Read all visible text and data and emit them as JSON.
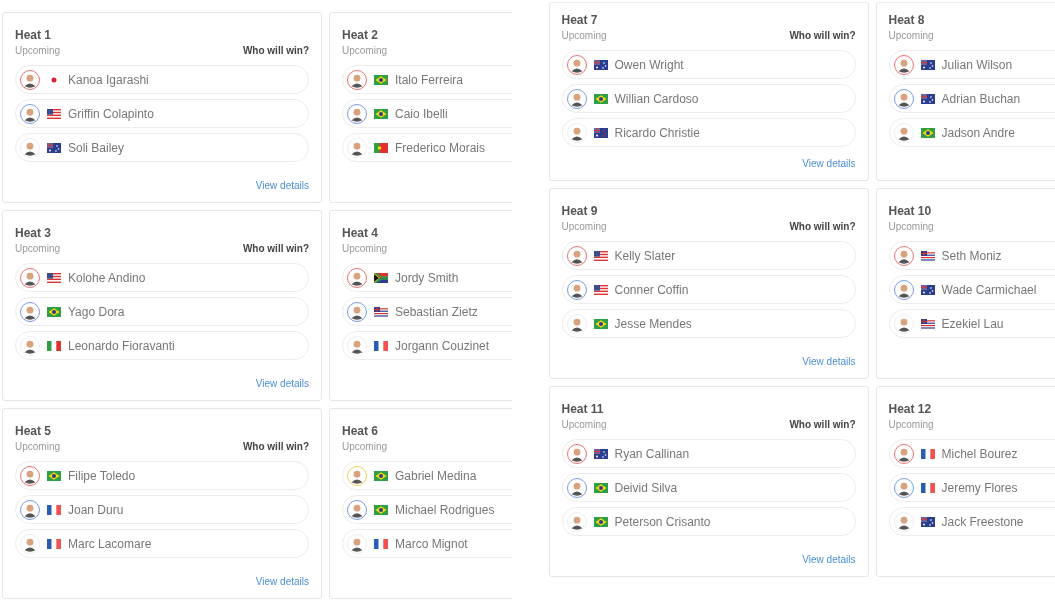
{
  "panels": [
    {
      "heats": [
        {
          "title": "Heat 1",
          "status": "Upcoming",
          "prompt": "Who will win?",
          "link": "View details",
          "surfers": [
            {
              "name": "Kanoa Igarashi",
              "kind": "jp",
              "color": "#e57373"
            },
            {
              "name": "Griffin Colapinto",
              "kind": "us",
              "color": "#7b9be0"
            },
            {
              "name": "Soli Bailey",
              "kind": "au",
              "color": "#eeeeee"
            }
          ]
        },
        {
          "title": "Heat 2",
          "status": "Upcoming",
          "surfers": [
            {
              "name": "Italo Ferreira",
              "kind": "br",
              "color": "#e57373"
            },
            {
              "name": "Caio Ibelli",
              "kind": "br",
              "color": "#7b9be0"
            },
            {
              "name": "Frederico Morais",
              "kind": "pt",
              "color": "#eeeeee"
            }
          ]
        },
        {
          "title": "Heat 3",
          "status": "Upcoming",
          "prompt": "Who will win?",
          "link": "View details",
          "surfers": [
            {
              "name": "Kolohe Andino",
              "kind": "us",
              "color": "#e57373"
            },
            {
              "name": "Yago Dora",
              "kind": "br",
              "color": "#7b9be0"
            },
            {
              "name": "Leonardo Fioravanti",
              "kind": "it",
              "color": "#eeeeee"
            }
          ]
        },
        {
          "title": "Heat 4",
          "status": "Upcoming",
          "surfers": [
            {
              "name": "Jordy Smith",
              "kind": "za",
              "color": "#e57373"
            },
            {
              "name": "Sebastian Zietz",
              "kind": "hi",
              "color": "#7b9be0"
            },
            {
              "name": "Jorgann Couzinet",
              "kind": "fr",
              "color": "#eeeeee"
            }
          ]
        },
        {
          "title": "Heat 5",
          "status": "Upcoming",
          "prompt": "Who will win?",
          "link": "View details",
          "surfers": [
            {
              "name": "Filipe Toledo",
              "kind": "br",
              "color": "#e57373"
            },
            {
              "name": "Joan Duru",
              "kind": "fr",
              "color": "#7b9be0"
            },
            {
              "name": "Marc Lacomare",
              "kind": "fr",
              "color": "#eeeeee"
            }
          ]
        },
        {
          "title": "Heat 6",
          "status": "Upcoming",
          "surfers": [
            {
              "name": "Gabriel Medina",
              "kind": "br",
              "color": "#f0d060"
            },
            {
              "name": "Michael Rodrigues",
              "kind": "br",
              "color": "#7b9be0"
            },
            {
              "name": "Marco Mignot",
              "kind": "fr",
              "color": "#eeeeee"
            }
          ]
        }
      ]
    },
    {
      "heats": [
        {
          "title": "Heat 7",
          "status": "Upcoming",
          "prompt": "Who will win?",
          "link": "View details",
          "surfers": [
            {
              "name": "Owen Wright",
              "kind": "au",
              "color": "#e57373"
            },
            {
              "name": "Willian Cardoso",
              "kind": "br",
              "color": "#7b9be0"
            },
            {
              "name": "Ricardo Christie",
              "kind": "nz",
              "color": "#eeeeee"
            }
          ]
        },
        {
          "title": "Heat 8",
          "status": "Upcoming",
          "surfers": [
            {
              "name": "Julian Wilson",
              "kind": "au",
              "color": "#e57373"
            },
            {
              "name": "Adrian Buchan",
              "kind": "au",
              "color": "#7b9be0"
            },
            {
              "name": "Jadson Andre",
              "kind": "br",
              "color": "#eeeeee"
            }
          ]
        },
        {
          "title": "Heat 9",
          "status": "Upcoming",
          "prompt": "Who will win?",
          "link": "View details",
          "surfers": [
            {
              "name": "Kelly Slater",
              "kind": "us",
              "color": "#e57373"
            },
            {
              "name": "Conner Coffin",
              "kind": "us",
              "color": "#7b9be0"
            },
            {
              "name": "Jesse Mendes",
              "kind": "br",
              "color": "#eeeeee"
            }
          ]
        },
        {
          "title": "Heat 10",
          "status": "Upcoming",
          "surfers": [
            {
              "name": "Seth Moniz",
              "kind": "hi",
              "color": "#e57373"
            },
            {
              "name": "Wade Carmichael",
              "kind": "au",
              "color": "#7b9be0"
            },
            {
              "name": "Ezekiel Lau",
              "kind": "hi",
              "color": "#eeeeee"
            }
          ]
        },
        {
          "title": "Heat 11",
          "status": "Upcoming",
          "prompt": "Who will win?",
          "link": "View details",
          "surfers": [
            {
              "name": "Ryan Callinan",
              "kind": "au",
              "color": "#e57373"
            },
            {
              "name": "Deivid Silva",
              "kind": "br",
              "color": "#7b9be0"
            },
            {
              "name": "Peterson Crisanto",
              "kind": "br",
              "color": "#eeeeee"
            }
          ]
        },
        {
          "title": "Heat 12",
          "status": "Upcoming",
          "surfers": [
            {
              "name": "Michel Bourez",
              "kind": "fr",
              "color": "#e57373"
            },
            {
              "name": "Jeremy Flores",
              "kind": "fr",
              "color": "#7b9be0"
            },
            {
              "name": "Jack Freestone",
              "kind": "au",
              "color": "#eeeeee"
            }
          ]
        }
      ]
    }
  ]
}
